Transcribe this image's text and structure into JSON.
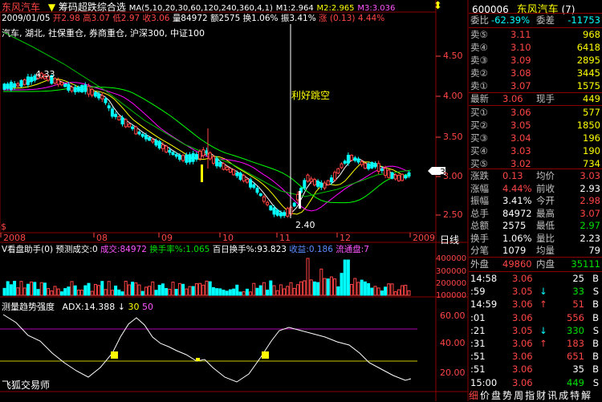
{
  "header": {
    "stock_name": "东风汽车",
    "indicator_name": "筹码超跌综合选",
    "ma_label": "MA(5,10,20,30,60,120,240,360,4,1)",
    "m1": "M1:2.964",
    "m2": "M2:2.965",
    "m3": "M3:3.036",
    "arrow_icon": "⬍"
  },
  "info_bar": {
    "date": "2009/01/05",
    "open": "开2.98",
    "high": "高3.07",
    "low": "低2.97",
    "close": "收3.06",
    "volume": "量84972",
    "amount": "额2575",
    "turnover": "换1.06%",
    "amplitude": "振3.41%",
    "change": "涨 (0.13)",
    "change_pct": "4.44%"
  },
  "concepts": "汽车, 湖北, 社保重仓, 券商重仓, 沪深300, 中证100",
  "main_chart": {
    "high_label": "4.33",
    "low_label": "2.40",
    "annotation": "利好跳空",
    "price_ticks": [
      "4.50",
      "4.00",
      "3.50",
      "3.00",
      "2.50"
    ],
    "current_price_marker": "3.06",
    "dollar_mark": "$"
  },
  "x_axis": {
    "months": [
      "2008",
      "08",
      "09",
      "10",
      "11",
      "12",
      "2009"
    ],
    "period": "日线"
  },
  "volume_panel": {
    "title": "V看盘助手(0)",
    "forecast": "预测成交:0",
    "turnover_vol": "成交:84972",
    "turnover_rate": "换手率%:1.065",
    "hundred_day": "百日换手%:93.823",
    "yield": "收益:0.186",
    "float_cap": "流通盘:7",
    "ticks": [
      "400000",
      "300000",
      "200000",
      "100000"
    ]
  },
  "adx_panel": {
    "title": "测量趋势强度",
    "adx": "ADX:14.388",
    "adx_arrow": "↓",
    "level_30": "30",
    "level_50": "50",
    "ticks": [
      "60.00",
      "40.00",
      "20.00"
    ],
    "footer": "飞狐交易师"
  },
  "right_panel": {
    "code": "600006",
    "name": "东风汽车",
    "badge": "(7)",
    "weibi_label": "委比",
    "weibi_value": "-62.39%",
    "weicha_label": "委差",
    "weicha_value": "-11753",
    "asks": [
      {
        "label": "卖⑤",
        "price": "3.11",
        "vol": "968"
      },
      {
        "label": "卖④",
        "price": "3.10",
        "vol": "6418"
      },
      {
        "label": "卖③",
        "price": "3.09",
        "vol": "2895"
      },
      {
        "label": "卖②",
        "price": "3.08",
        "vol": "3445"
      },
      {
        "label": "卖①",
        "price": "3.07",
        "vol": "1575"
      }
    ],
    "latest_label": "最新",
    "latest_value": "3.06",
    "xianshou_label": "现手",
    "xianshou_value": "449",
    "bids": [
      {
        "label": "买①",
        "price": "3.06",
        "vol": "577"
      },
      {
        "label": "买②",
        "price": "3.05",
        "vol": "1850"
      },
      {
        "label": "买③",
        "price": "3.04",
        "vol": "196"
      },
      {
        "label": "买④",
        "price": "3.03",
        "vol": "190"
      },
      {
        "label": "买⑤",
        "price": "3.02",
        "vol": "734"
      }
    ],
    "stats": [
      {
        "l1": "涨跌",
        "v1": "0.13",
        "c1": "red",
        "l2": "均价",
        "v2": "3.03",
        "c2": "red"
      },
      {
        "l1": "涨幅",
        "v1": "4.44%",
        "c1": "red",
        "l2": "前收",
        "v2": "2.93",
        "c2": "white"
      },
      {
        "l1": "振幅",
        "v1": "3.41%",
        "c1": "white",
        "l2": "今开",
        "v2": "2.98",
        "c2": "red"
      },
      {
        "l1": "总手",
        "v1": "84972",
        "c1": "white",
        "l2": "最高",
        "v2": "3.07",
        "c2": "red"
      },
      {
        "l1": "总额",
        "v1": "2575",
        "c1": "white",
        "l2": "最低",
        "v2": "2.97",
        "c2": "green"
      },
      {
        "l1": "换手",
        "v1": "1.06%",
        "c1": "white",
        "l2": "量比",
        "v2": "2.23",
        "c2": "white"
      },
      {
        "l1": "分笔",
        "v1": "1079",
        "c1": "white",
        "l2": "均量",
        "v2": "79",
        "c2": "white"
      }
    ],
    "outer_label": "外盘",
    "outer_value": "49860",
    "inner_label": "内盘",
    "inner_value": "35111",
    "ticks": [
      {
        "time": "14:58",
        "price": "3.06",
        "arrow": "",
        "vol": "25",
        "side": "B",
        "side_color": "white"
      },
      {
        "time": ":59",
        "price": "3.05",
        "arrow": "↓",
        "vol": "33",
        "side": "S",
        "side_color": "green"
      },
      {
        "time": "14:59",
        "price": "3.06",
        "arrow": "↑",
        "vol": "51",
        "side": "B",
        "side_color": "red"
      },
      {
        "time": ":01",
        "price": "3.06",
        "arrow": "",
        "vol": "556",
        "side": "B",
        "side_color": "red"
      },
      {
        "time": ":21",
        "price": "3.05",
        "arrow": "↓",
        "vol": "330",
        "side": "S",
        "side_color": "green"
      },
      {
        "time": ":31",
        "price": "3.06",
        "arrow": "↑",
        "vol": "183",
        "side": "B",
        "side_color": "red"
      },
      {
        "time": ":51",
        "price": "3.06",
        "arrow": "",
        "vol": "651",
        "side": "B",
        "side_color": "red"
      },
      {
        "time": ":51",
        "price": "3.06",
        "arrow": "",
        "vol": "35",
        "side": "B",
        "side_color": "white"
      },
      {
        "time": "15:00",
        "price": "3.06",
        "arrow": "",
        "vol": "449",
        "side": "S",
        "side_color": "green"
      }
    ],
    "bottom_tabs": [
      "细",
      "价",
      "盘",
      "势",
      "周",
      "指",
      "财",
      "讯",
      "成",
      "特",
      "解"
    ]
  },
  "colors": {
    "up": "#ff4545",
    "down": "#00ffff",
    "grid": "#8b0000",
    "ma5": "#ffffff",
    "ma10": "#ffff00",
    "ma20": "#ff00ff",
    "ma30": "#00ff00"
  }
}
